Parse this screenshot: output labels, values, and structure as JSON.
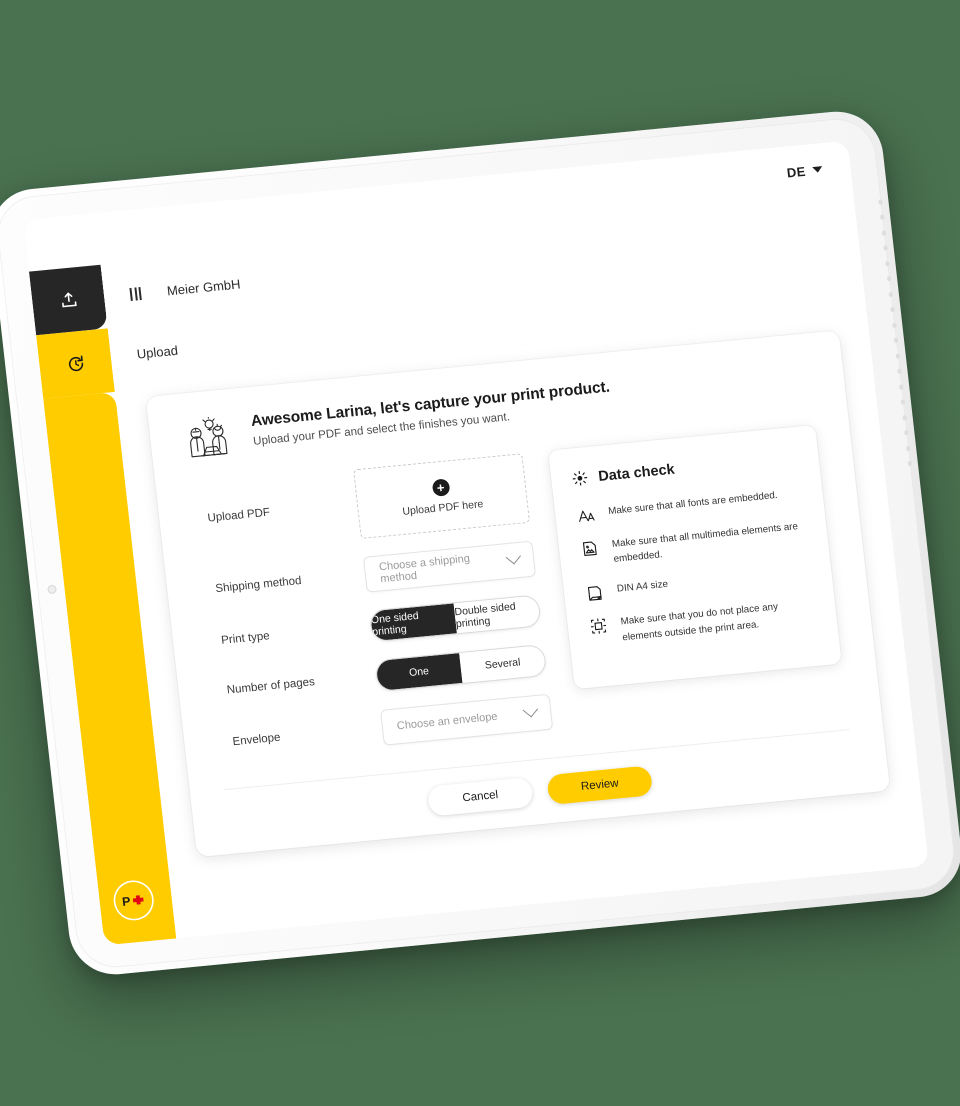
{
  "theme": {
    "accent": "#FFCC00",
    "dark": "#262626",
    "background": "#4A7150"
  },
  "statusbar": {
    "language": "DE",
    "caret_icon": "chevron-down-icon"
  },
  "rail": {
    "upload_icon": "upload-tray-icon",
    "history_icon": "history-clock-icon",
    "logo": "swiss-post-logo"
  },
  "topbar": {
    "menu_icon": "hamburger-icon",
    "org_name": "Meier GmbH"
  },
  "subbar": {
    "label": "Upload"
  },
  "card": {
    "illustration_icon": "people-idea-illustration",
    "heading": "Awesome Larina, let's capture your print product.",
    "subheading": "Upload your PDF and select the finishes you want."
  },
  "form": {
    "upload": {
      "label": "Upload PDF",
      "plus_icon": "plus-circle-icon",
      "dropzone_text": "Upload PDF here"
    },
    "shipping": {
      "label": "Shipping method",
      "placeholder": "Choose a shipping method",
      "value": "",
      "chevron_icon": "chevron-down-icon"
    },
    "print_type": {
      "label": "Print type",
      "options": [
        "One sided printing",
        "Double sided printing"
      ],
      "selected": "One sided printing"
    },
    "pages": {
      "label": "Number of pages",
      "options": [
        "One",
        "Several"
      ],
      "selected": "One"
    },
    "envelope": {
      "label": "Envelope",
      "placeholder": "Choose an envelope",
      "value": "",
      "chevron_icon": "chevron-down-icon"
    }
  },
  "data_check": {
    "title": "Data check",
    "title_icon": "lightbulb-icon",
    "items": [
      {
        "icon": "font-aa-icon",
        "text": "Make sure that all fonts are embedded."
      },
      {
        "icon": "image-icon",
        "text": "Make sure that all multimedia elements are embedded."
      },
      {
        "icon": "page-icon",
        "text": "DIN A4 size"
      },
      {
        "icon": "crop-marks-icon",
        "text": "Make sure that you do not place any elements outside the print area."
      }
    ]
  },
  "footer": {
    "cancel_label": "Cancel",
    "review_label": "Review"
  }
}
